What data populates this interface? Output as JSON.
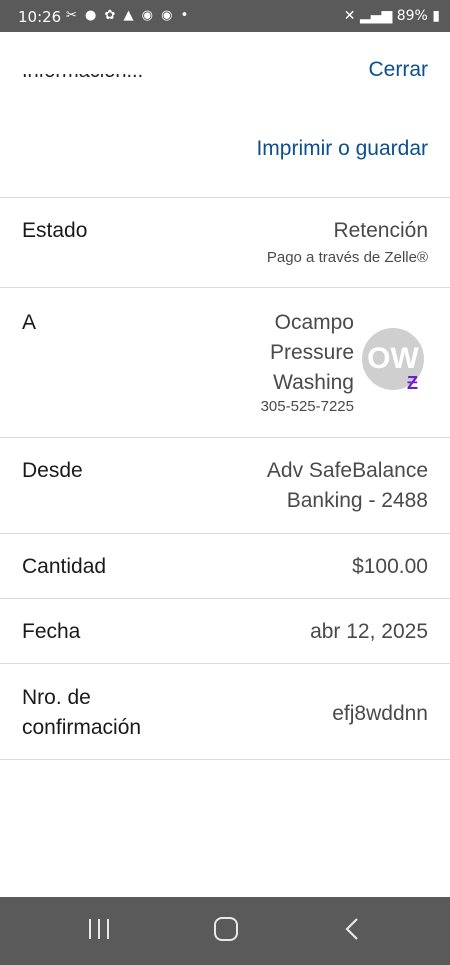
{
  "status_bar": {
    "time": "10:26",
    "battery": "89%"
  },
  "header": {
    "title": "Información...",
    "close_label": "Cerrar",
    "print_label": "Imprimir o guardar"
  },
  "details": {
    "estado": {
      "label": "Estado",
      "value": "Retención",
      "sub": "Pago a través de Zelle®"
    },
    "a": {
      "label": "A",
      "name_lines": [
        "Ocampo",
        "Pressure",
        "Washing"
      ],
      "phone": "305-525-7225",
      "avatar_initials": "OW"
    },
    "desde": {
      "label": "Desde",
      "value_lines": [
        "Adv SafeBalance",
        "Banking - 2488"
      ]
    },
    "cantidad": {
      "label": "Cantidad",
      "value": "$100.00"
    },
    "fecha": {
      "label": "Fecha",
      "value": "abr 12, 2025"
    },
    "confirmacion": {
      "label_lines": [
        "Nro. de",
        "confirmación"
      ],
      "value": "efj8wddnn"
    }
  },
  "colors": {
    "link": "#0b4f8f",
    "zelle": "#6d1ed4",
    "system_bar": "#5a5a5a"
  },
  "icons": {
    "zelle": "zelle-icon",
    "recents": "recents-icon",
    "home": "home-icon",
    "back": "back-icon"
  }
}
